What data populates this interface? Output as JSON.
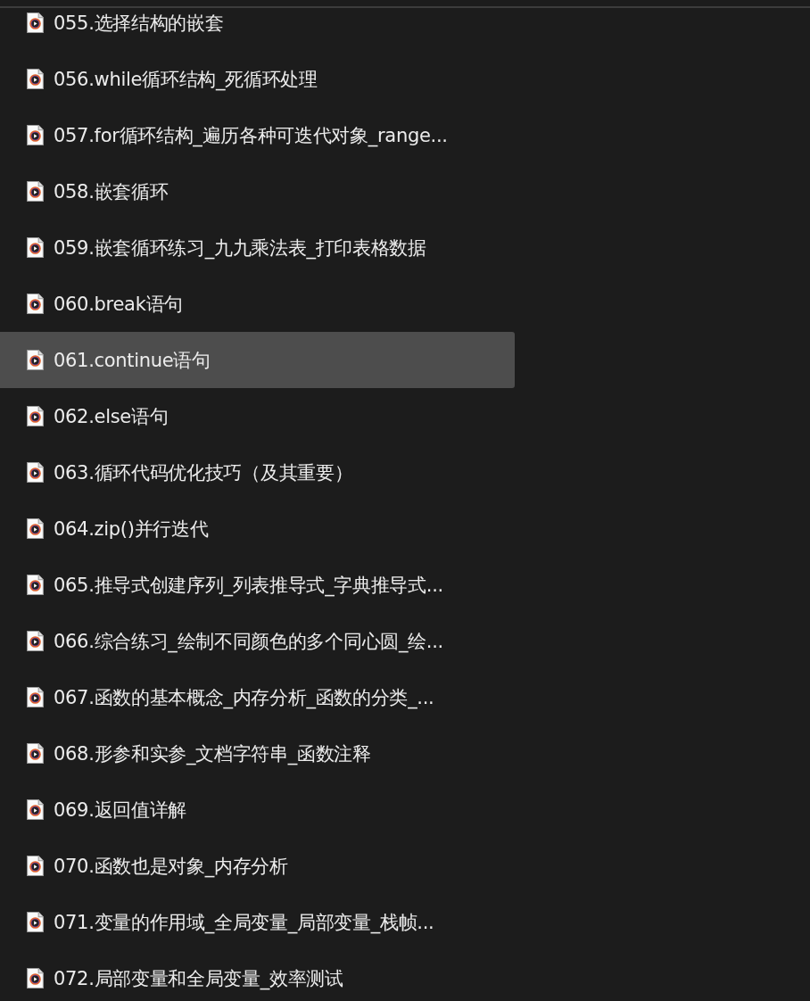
{
  "items": [
    {
      "label": "055.选择结构的嵌套",
      "selected": false
    },
    {
      "label": "056.while循环结构_死循环处理",
      "selected": false
    },
    {
      "label": "057.for循环结构_遍历各种可迭代对象_range...",
      "selected": false
    },
    {
      "label": "058.嵌套循环",
      "selected": false
    },
    {
      "label": "059.嵌套循环练习_九九乘法表_打印表格数据",
      "selected": false
    },
    {
      "label": "060.break语句",
      "selected": false
    },
    {
      "label": "061.continue语句",
      "selected": true
    },
    {
      "label": "062.else语句",
      "selected": false
    },
    {
      "label": "063.循环代码优化技巧（及其重要）",
      "selected": false
    },
    {
      "label": "064.zip()并行迭代",
      "selected": false
    },
    {
      "label": "065.推导式创建序列_列表推导式_字典推导式...",
      "selected": false
    },
    {
      "label": "066.综合练习_绘制不同颜色的多个同心圆_绘...",
      "selected": false
    },
    {
      "label": "067.函数的基本概念_内存分析_函数的分类_...",
      "selected": false
    },
    {
      "label": "068.形参和实参_文档字符串_函数注释",
      "selected": false
    },
    {
      "label": "069.返回值详解",
      "selected": false
    },
    {
      "label": "070.函数也是对象_内存分析",
      "selected": false
    },
    {
      "label": "071.变量的作用域_全局变量_局部变量_栈帧...",
      "selected": false
    },
    {
      "label": "072.局部变量和全局变量_效率测试",
      "selected": false
    }
  ]
}
